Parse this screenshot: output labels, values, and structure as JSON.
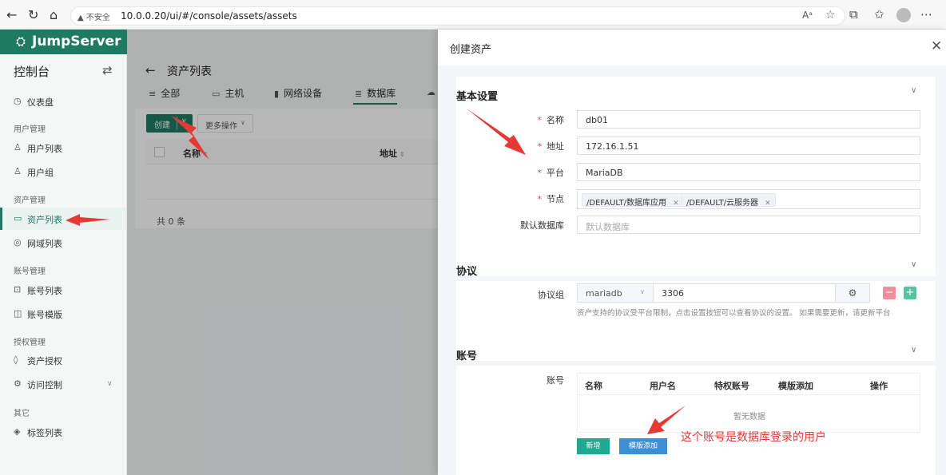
{
  "browser": {
    "security_label": "不安全",
    "url": "10.0.0.20/ui/#/console/assets/assets"
  },
  "app": {
    "logo": "JumpServer",
    "console_title": "控制台"
  },
  "sidebar": {
    "dashboard": "仪表盘",
    "groups": [
      {
        "title": "用户管理",
        "items": [
          "用户列表",
          "用户组"
        ]
      },
      {
        "title": "资产管理",
        "items": [
          "资产列表",
          "网域列表"
        ]
      },
      {
        "title": "账号管理",
        "items": [
          "账号列表",
          "账号模版"
        ]
      },
      {
        "title": "授权管理",
        "items": [
          "资产授权",
          "访问控制"
        ]
      },
      {
        "title": "其它",
        "items": [
          "标签列表"
        ]
      }
    ],
    "active_item": "资产列表"
  },
  "main": {
    "page_title": "资产列表",
    "tabs": [
      "全部",
      "主机",
      "网络设备",
      "数据库"
    ],
    "active_tab": "数据库",
    "create_button": "创建",
    "more_button": "更多操作",
    "columns": [
      "名称",
      "地址"
    ],
    "total": "共 0 条"
  },
  "drawer": {
    "title": "创建资产",
    "basic": {
      "title": "基本设置",
      "name_label": "名称",
      "name_value": "db01",
      "address_label": "地址",
      "address_value": "172.16.1.51",
      "platform_label": "平台",
      "platform_value": "MariaDB",
      "node_label": "节点",
      "nodes": [
        "/DEFAULT/数据库应用",
        "/DEFAULT/云服务器"
      ],
      "default_db_label": "默认数据库",
      "default_db_placeholder": "默认数据库"
    },
    "protocol": {
      "title": "协议",
      "group_label": "协议组",
      "protocol_value": "mariadb",
      "port_value": "3306",
      "help": "资产支持的协议受平台限制，点击设置按钮可以查看协议的设置。 如果需要更新，请更新平台"
    },
    "account": {
      "title": "账号",
      "label": "账号",
      "columns": [
        "名称",
        "用户名",
        "特权账号",
        "模版添加",
        "操作"
      ],
      "empty": "暂无数据",
      "new_button": "新增",
      "template_button": "模版添加"
    }
  },
  "annotation": "这个账号是数据库登录的用户",
  "colors": {
    "brand": "#1f7a62",
    "annotation": "#e53935"
  }
}
